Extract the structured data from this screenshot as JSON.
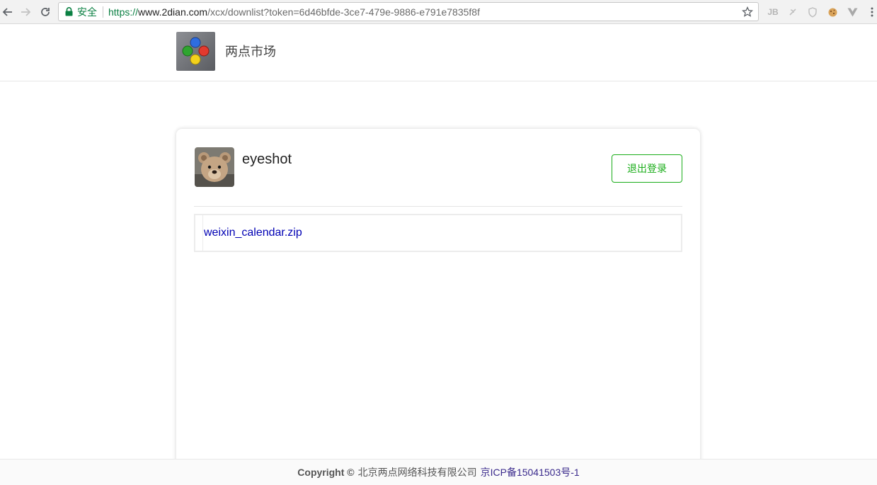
{
  "browser": {
    "secure_label": "安全",
    "url_scheme": "https://",
    "url_host": "www.2dian.com",
    "url_path": "/xcx/downlist?token=6d46bfde-3ce7-479e-9886-e791e7835f8f",
    "extensions": [
      "JB",
      "ƨ",
      "◇",
      "●",
      "V"
    ]
  },
  "header": {
    "site_title": "两点市场"
  },
  "user": {
    "username": "eyeshot",
    "logout_label": "退出登录"
  },
  "files": [
    {
      "name": "weixin_calendar.zip"
    }
  ],
  "footer": {
    "copyright": "Copyright ©",
    "company": "北京两点网络科技有限公司",
    "icp": "京ICP备15041503号-1"
  },
  "colors": {
    "accent_green": "#1aad19",
    "link_blue": "#0000b4",
    "secure_green": "#0b8043"
  }
}
